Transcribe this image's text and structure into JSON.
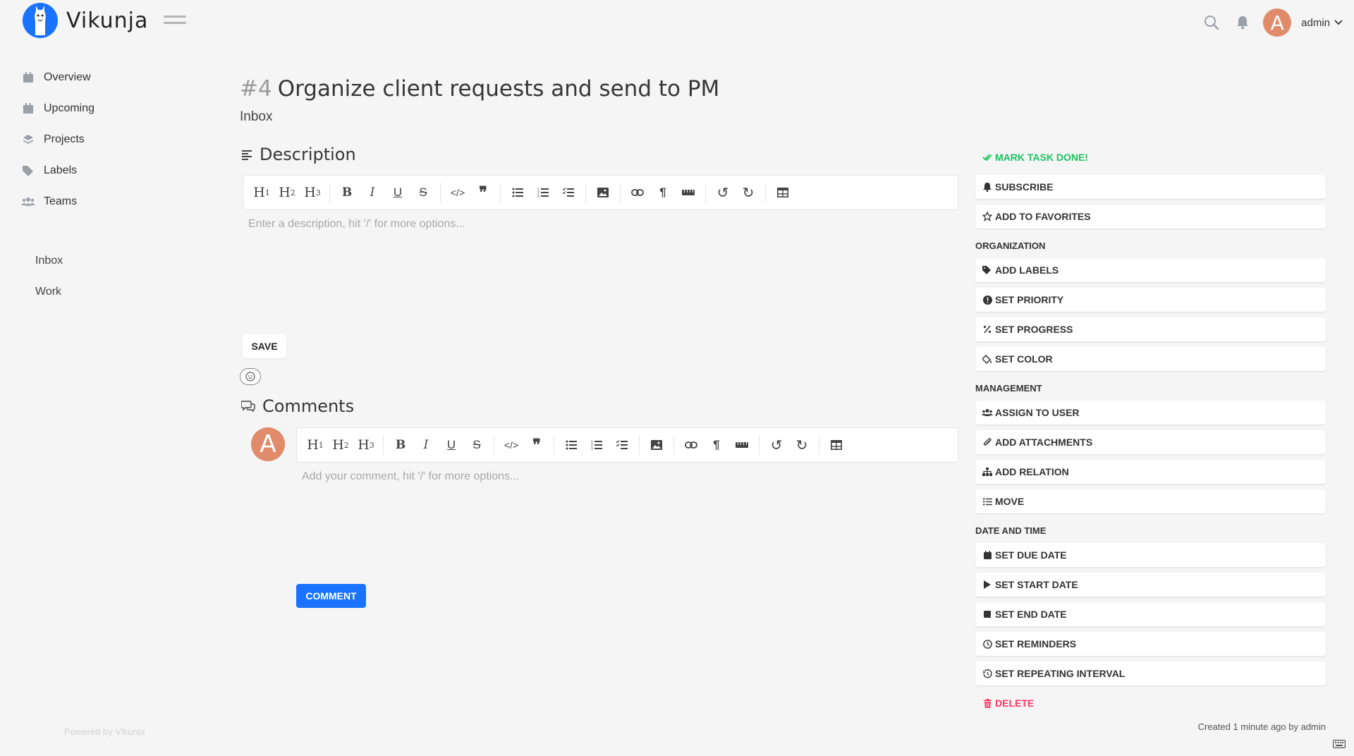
{
  "app": {
    "name": "Vikunja"
  },
  "header": {
    "user_name": "admin",
    "avatar_letter": "A"
  },
  "sidebar": {
    "items": [
      {
        "label": "Overview",
        "icon": "calendar-icon"
      },
      {
        "label": "Upcoming",
        "icon": "calendar-week-icon"
      },
      {
        "label": "Projects",
        "icon": "layers-icon"
      },
      {
        "label": "Labels",
        "icon": "tags-icon"
      },
      {
        "label": "Teams",
        "icon": "users-icon"
      }
    ],
    "projects": [
      "Inbox",
      "Work"
    ],
    "powered_by": "Powered by Vikunja"
  },
  "task": {
    "id": "#4",
    "title": "Organize client requests and send to PM",
    "project": "Inbox",
    "description_heading": "Description",
    "description_placeholder": "Enter a description, hit '/' for more options...",
    "save_label": "SAVE",
    "comments_heading": "Comments",
    "comment_placeholder": "Add your comment, hit '/' for more options...",
    "comment_label": "COMMENT",
    "created": "Created 1 minute ago by admin"
  },
  "actions": {
    "mark_done": "MARK TASK DONE!",
    "subscribe": "SUBSCRIBE",
    "favorites": "ADD TO FAVORITES",
    "organization_heading": "ORGANIZATION",
    "add_labels": "ADD LABELS",
    "set_priority": "SET PRIORITY",
    "set_progress": "SET PROGRESS",
    "set_color": "SET COLOR",
    "management_heading": "MANAGEMENT",
    "assign_to_user": "ASSIGN TO USER",
    "add_attachments": "ADD ATTACHMENTS",
    "add_relation": "ADD RELATION",
    "move": "MOVE",
    "date_heading": "DATE AND TIME",
    "set_due_date": "SET DUE DATE",
    "set_start_date": "SET START DATE",
    "set_end_date": "SET END DATE",
    "set_reminders": "SET REMINDERS",
    "set_repeating": "SET REPEATING INTERVAL",
    "delete": "DELETE"
  },
  "colors": {
    "primary": "#1973ff",
    "success": "#1cc35f",
    "danger": "#ff3860",
    "avatar": "#e08b6a"
  }
}
